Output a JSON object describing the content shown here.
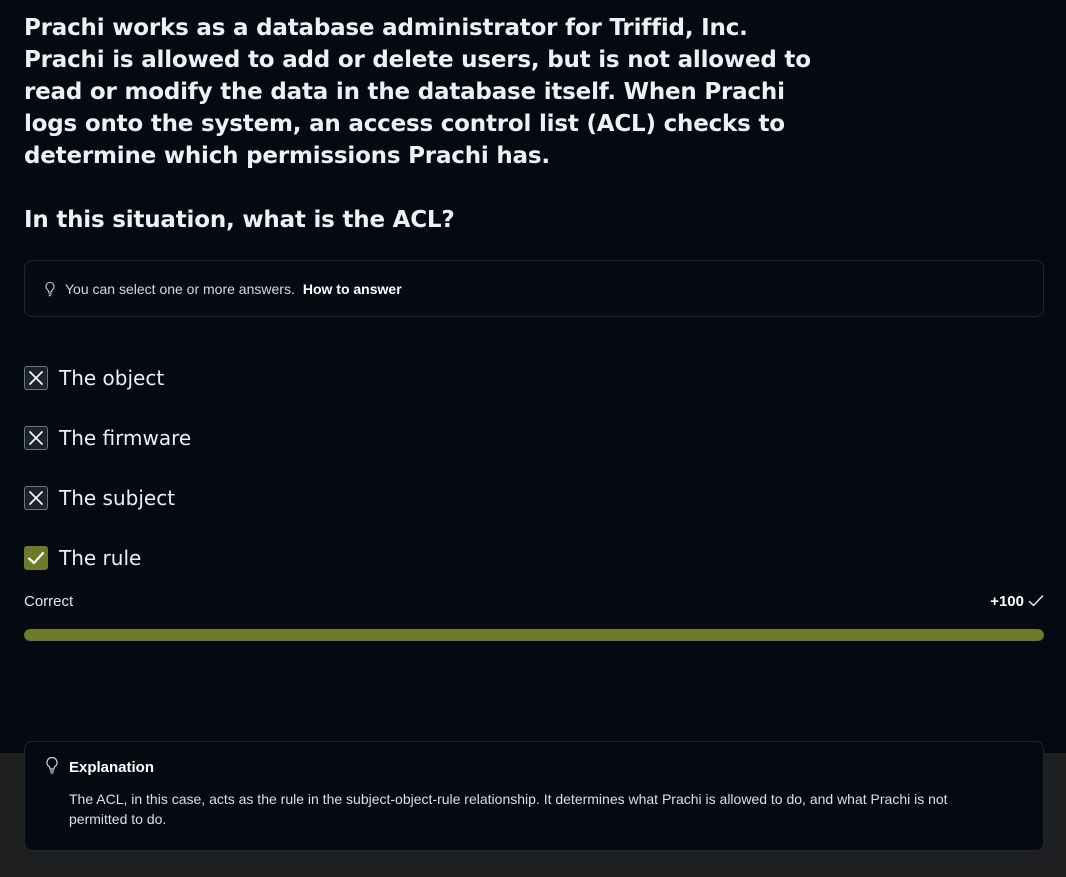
{
  "question": {
    "text": "Prachi works as a database administrator for Triffid, Inc. Prachi is allowed to add or delete users, but is not allowed to read or modify the data in the database itself. When Prachi logs onto the system, an access control list (ACL) checks to determine which permissions Prachi has.",
    "prompt": "In this situation, what is the ACL?"
  },
  "hint": {
    "icon": "lightbulb-icon",
    "text": "You can select one or more answers.",
    "link": "How to answer"
  },
  "options": [
    {
      "label": "The object",
      "state": "incorrect",
      "icon": "x-icon"
    },
    {
      "label": "The firmware",
      "state": "incorrect",
      "icon": "x-icon"
    },
    {
      "label": "The subject",
      "state": "incorrect",
      "icon": "x-icon"
    },
    {
      "label": "The rule",
      "state": "correct",
      "icon": "check-icon"
    }
  ],
  "result": {
    "status": "Correct",
    "score": "+100",
    "progress_percent": 100
  },
  "explanation": {
    "icon": "lightbulb-icon",
    "title": "Explanation",
    "body": "The ACL, in this case, acts as the rule in the subject-object-rule relationship. It determines what Prachi is allowed to do, and what Prachi is not permitted to do."
  },
  "colors": {
    "background": "#050a12",
    "accent_correct": "#6d7a2a",
    "bottom_band": "#1e1f21"
  }
}
